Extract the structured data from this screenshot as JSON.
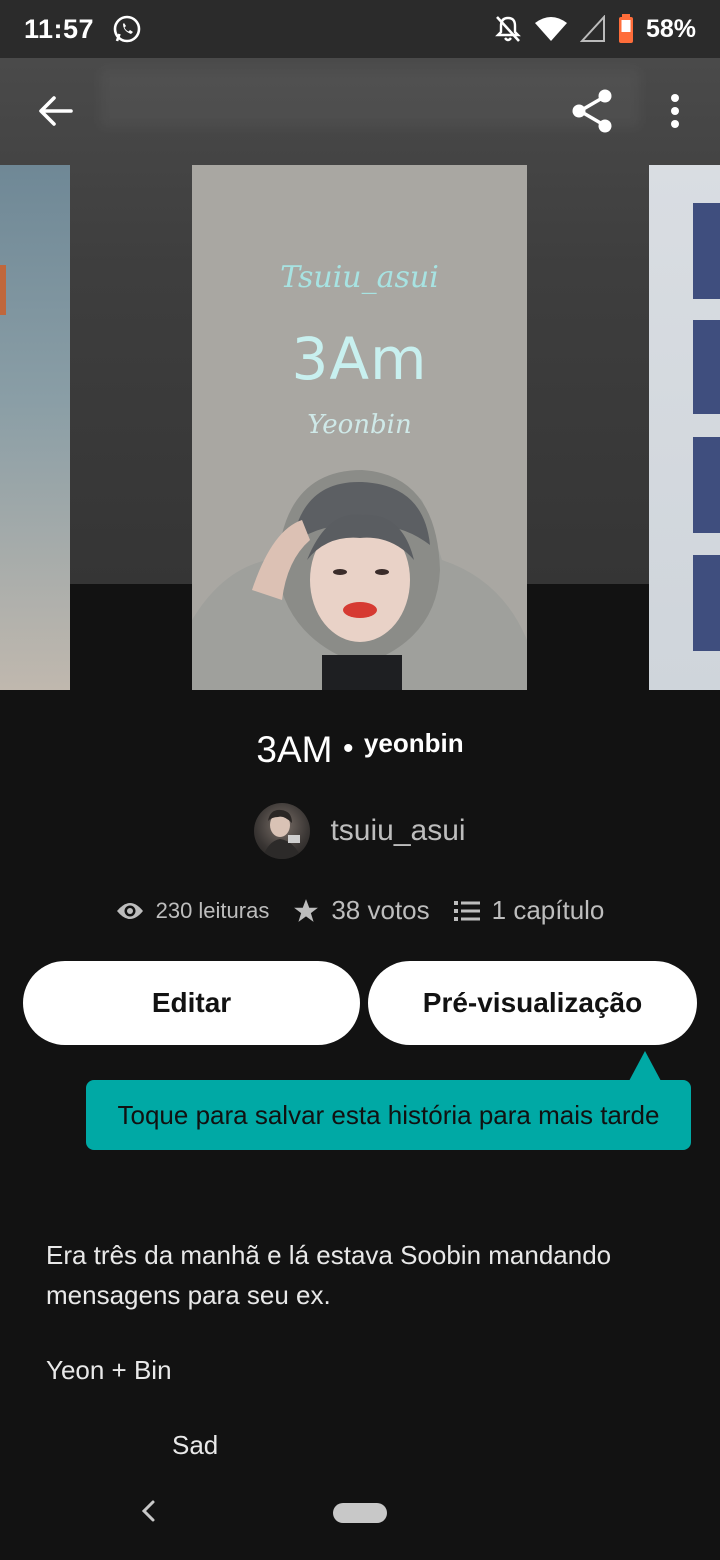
{
  "status_bar": {
    "time": "11:57",
    "battery": "58%",
    "icons": [
      "whatsapp-icon",
      "notifications-off-icon",
      "wifi-icon",
      "cell-signal-icon",
      "battery-icon"
    ]
  },
  "toolbar": {
    "icons": [
      "back-arrow-icon",
      "share-icon",
      "more-vertical-icon"
    ]
  },
  "cover": {
    "author_script": "Tsuiu_asui",
    "title": "3Am",
    "subtitle": "Yeonbin"
  },
  "story": {
    "title": "3AM",
    "separator": "•",
    "subtitle": "yeonbin",
    "author": "tsuiu_asui"
  },
  "stats": {
    "reads": "230 leituras",
    "votes": "38 votos",
    "chapters": "1 capítulo"
  },
  "actions": {
    "edit_label": "Editar",
    "preview_label": "Pré-visualização"
  },
  "tooltip": {
    "text": "Toque para salvar esta história para mais tarde"
  },
  "description": {
    "para1": "Era três da manhã e lá estava Soobin mandando mensagens para seu ex.",
    "para2": "Yeon + Bin",
    "para3": "Sad"
  },
  "colors": {
    "accent": "#00a9a5",
    "background": "#121212",
    "button_bg": "#ffffff"
  }
}
